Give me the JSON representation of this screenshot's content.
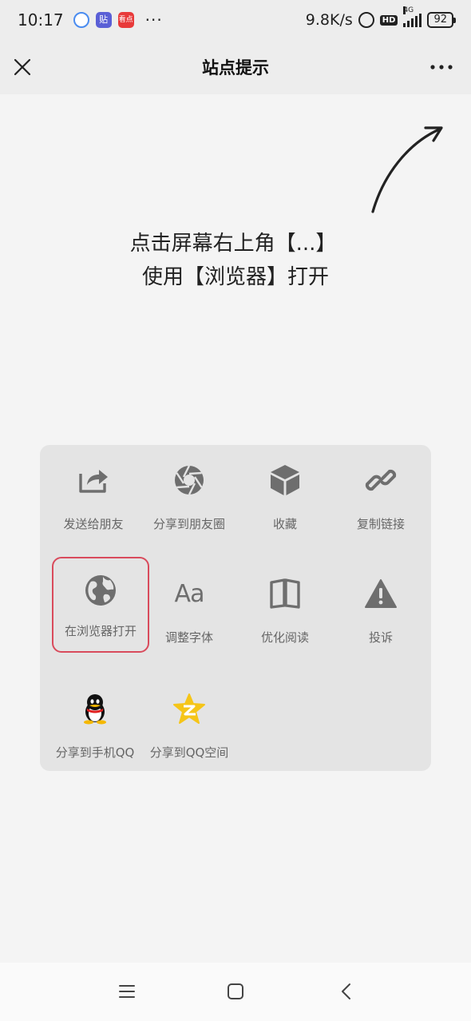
{
  "status_bar": {
    "time": "10:17",
    "dots": "···",
    "network_speed": "9.8K/s",
    "hd_label": "HD",
    "network_type": "4G",
    "battery": "92",
    "news_label": "看点",
    "tieba_label": "贴"
  },
  "nav": {
    "title": "站点提示"
  },
  "hint": {
    "line1": "点击屏幕右上角【...】",
    "line2": "使用【浏览器】打开"
  },
  "share_panel": {
    "items": [
      {
        "label": "发送给朋友",
        "icon": "share-icon"
      },
      {
        "label": "分享到朋友圈",
        "icon": "moments-icon"
      },
      {
        "label": "收藏",
        "icon": "favorite-cube-icon"
      },
      {
        "label": "复制链接",
        "icon": "link-icon"
      },
      {
        "label": "在浏览器打开",
        "icon": "globe-icon",
        "highlighted": true
      },
      {
        "label": "调整字体",
        "icon": "font-icon",
        "glyph": "Aa"
      },
      {
        "label": "优化阅读",
        "icon": "book-icon"
      },
      {
        "label": "投诉",
        "icon": "warning-icon"
      },
      {
        "label": "分享到手机QQ",
        "icon": "qq-icon"
      },
      {
        "label": "分享到QQ空间",
        "icon": "qzone-icon"
      }
    ]
  },
  "colors": {
    "background": "#f4f4f4",
    "bar": "#ededed",
    "panel": "#e4e4e4",
    "highlight_border": "#d94b5c",
    "icon_gray": "#6e6e6e",
    "qzone_yellow": "#f5c518"
  }
}
